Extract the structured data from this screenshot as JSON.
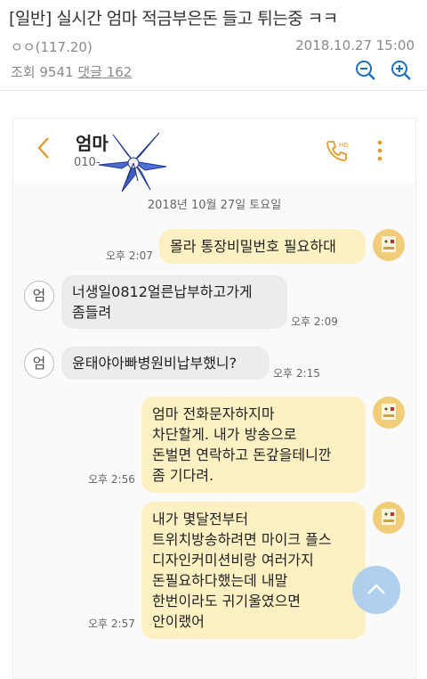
{
  "post": {
    "title": "[일반] 실시간 엄마 적금부은돈 들고 튀는중 ㅋㅋ",
    "author": "ㅇㅇ(117.20)",
    "datetime": "2018.10.27 15:00",
    "views": "조회 9541",
    "comments": "댓글 162"
  },
  "chat": {
    "contact_name": "엄마",
    "contact_number": "010-",
    "date": "2018년 10월 27일 토요일",
    "avatar_letter": "엄",
    "messages": [
      {
        "side": "sent",
        "text": "몰라 통장비밀번호 필요하대",
        "time": "오후 2:07"
      },
      {
        "side": "recv",
        "text": "너생일0812얼른납부하고가게\n좀들려",
        "time": "오후 2:09"
      },
      {
        "side": "recv",
        "text": "윤태야아빠병원비납부했니?",
        "time": "오후 2:15"
      },
      {
        "side": "sent",
        "text": "엄마 전화문자하지마\n차단할게. 내가 방송으로\n돈벌면 연락하고 돈갚을테니깐\n좀 기다려.",
        "time": "오후 2:56"
      },
      {
        "side": "sent",
        "text": "내가 몇달전부터\n트위치방송하려면 마이크 플스\n디자인커미션비랑 여러가지\n돈필요하다했는데 내말\n한번이라도 귀기울였으면\n안이랬어",
        "time": "오후 2:57"
      }
    ]
  },
  "colors": {
    "sent_bubble": "#fdf1c4",
    "recv_bubble": "#ececec",
    "accent": "#e29a2c",
    "scroll_button": "#a9ccef"
  },
  "icons": [
    "zoom-out-icon",
    "zoom-in-icon",
    "back-icon",
    "lily-flower-icon",
    "call-icon",
    "more-vertical-icon",
    "chevron-up-icon"
  ]
}
